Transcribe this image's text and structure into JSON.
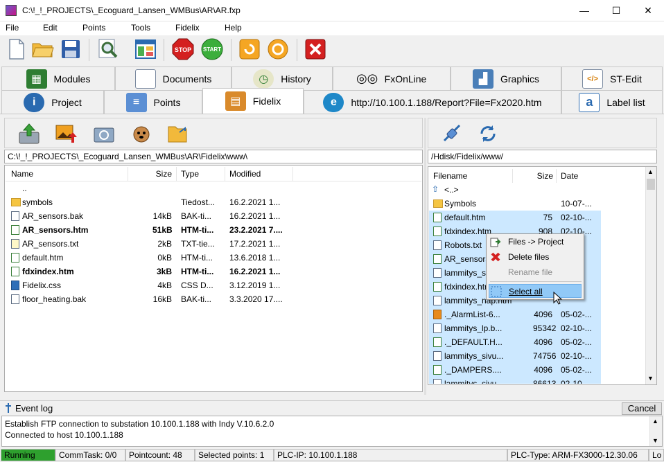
{
  "window": {
    "title": "C:\\!_!_PROJECTS\\_Ecoguard_Lansen_WMBus\\AR\\AR.fxp",
    "minimize": "—",
    "maximize": "☐",
    "close": "✕"
  },
  "menu": [
    "File",
    "Edit",
    "Points",
    "Tools",
    "Fidelix",
    "Help"
  ],
  "toolbar": {
    "stop_label": "STOP",
    "start_label": "START"
  },
  "tabs_top": [
    "Modules",
    "Documents",
    "History",
    "FxOnLine",
    "Graphics",
    "ST-Edit"
  ],
  "tabs_bottom": [
    "Project",
    "Points",
    "Fidelix",
    "http://10.100.1.188/Report?File=Fx2020.htm",
    "Label list"
  ],
  "active_tab": "Fidelix",
  "left_panel": {
    "path": "C:\\!_!_PROJECTS\\_Ecoguard_Lansen_WMBus\\AR\\Fidelix\\www\\",
    "columns": [
      "Name",
      "Size",
      "Type",
      "Modified"
    ],
    "rows": [
      {
        "name": "..",
        "size": "",
        "type": "",
        "modified": "",
        "icon": "none",
        "bold": false
      },
      {
        "name": "symbols",
        "size": "",
        "type": "Tiedost...",
        "modified": "16.2.2021 1...",
        "icon": "folder",
        "bold": false
      },
      {
        "name": "AR_sensors.bak",
        "size": "14kB",
        "type": "BAK-ti...",
        "modified": "16.2.2021 1...",
        "icon": "file",
        "bold": false
      },
      {
        "name": "AR_sensors.htm",
        "size": "51kB",
        "type": "HTM-ti...",
        "modified": "23.2.2021 7....",
        "icon": "htm",
        "bold": true
      },
      {
        "name": "AR_sensors.txt",
        "size": "2kB",
        "type": "TXT-tie...",
        "modified": "17.2.2021 1...",
        "icon": "txt",
        "bold": false
      },
      {
        "name": "default.htm",
        "size": "0kB",
        "type": "HTM-ti...",
        "modified": "13.6.2018 1...",
        "icon": "htm",
        "bold": false
      },
      {
        "name": "fdxindex.htm",
        "size": "3kB",
        "type": "HTM-ti...",
        "modified": "16.2.2021 1...",
        "icon": "htm",
        "bold": true
      },
      {
        "name": "Fidelix.css",
        "size": "4kB",
        "type": "CSS D...",
        "modified": "3.12.2019 1...",
        "icon": "css",
        "bold": false
      },
      {
        "name": "floor_heating.bak",
        "size": "16kB",
        "type": "BAK-ti...",
        "modified": "3.3.2020 17....",
        "icon": "file",
        "bold": false
      }
    ]
  },
  "right_panel": {
    "path": "/Hdisk/Fidelix/www/",
    "columns": [
      "Filename",
      "Size",
      "Date"
    ],
    "rows": [
      {
        "name": "<..>",
        "size": "",
        "date": "",
        "icon": "up",
        "selected": false
      },
      {
        "name": "Symbols",
        "size": "",
        "date": "10-07-...",
        "icon": "folder",
        "selected": false
      },
      {
        "name": "default.htm",
        "size": "75",
        "date": "02-10-...",
        "icon": "htm",
        "selected": true
      },
      {
        "name": "fdxindex.htm",
        "size": "908",
        "date": "02-10-...",
        "icon": "htm",
        "selected": true
      },
      {
        "name": "Robots.txt",
        "size": "",
        "date": "",
        "icon": "file",
        "selected": true
      },
      {
        "name": "AR_sensors.htm",
        "size": "",
        "date": "",
        "icon": "htm",
        "selected": true
      },
      {
        "name": "lammitys_sivu.htm",
        "size": "",
        "date": "",
        "icon": "file",
        "selected": true
      },
      {
        "name": "fdxindex.htm",
        "size": "",
        "date": "",
        "icon": "htm",
        "selected": true
      },
      {
        "name": "lammitys_nap.htm",
        "size": "",
        "date": "",
        "icon": "file",
        "selected": true
      },
      {
        "name": "._AlarmList-6...",
        "size": "4096",
        "date": "05-02-...",
        "icon": "img",
        "selected": true
      },
      {
        "name": "lammitys_lp.b...",
        "size": "95342",
        "date": "02-10-...",
        "icon": "file",
        "selected": true
      },
      {
        "name": "._DEFAULT.H...",
        "size": "4096",
        "date": "05-02-...",
        "icon": "htm",
        "selected": true
      },
      {
        "name": "lammitys_sivu...",
        "size": "74756",
        "date": "02-10-...",
        "icon": "file",
        "selected": true
      },
      {
        "name": "._DAMPERS....",
        "size": "4096",
        "date": "05-02-...",
        "icon": "htm",
        "selected": true
      },
      {
        "name": "lammitys_sivu...",
        "size": "86613",
        "date": "02-10-...",
        "icon": "file",
        "selected": true
      }
    ]
  },
  "context_menu": {
    "items": [
      {
        "label": "Files -> Project",
        "enabled": true,
        "icon": "files-to-project-icon"
      },
      {
        "label": "Delete files",
        "enabled": true,
        "icon": "delete-icon"
      },
      {
        "label": "Rename file",
        "enabled": false,
        "icon": "none"
      },
      {
        "label": "Select all",
        "enabled": true,
        "icon": "select-all-icon"
      }
    ]
  },
  "event_log": {
    "title": "Event log",
    "cancel_label": "Cancel",
    "lines": [
      "Establish FTP connection to substation 10.100.1.188 with Indy V.10.6.2.0",
      "Connected to host 10.100.1.188"
    ]
  },
  "status": {
    "state": "Running",
    "commtask": "CommTask: 0/0",
    "pointcount": "Pointcount: 48",
    "selected": "Selected points: 1",
    "plc_ip": "PLC-IP: 10.100.1.188",
    "plc_type": "PLC-Type: ARM-FX3000-12.30.06",
    "extra": "Lo"
  },
  "colors": {
    "selection": "#cce8ff",
    "running": "#2ea02e",
    "active_tab": "#ffffff"
  }
}
